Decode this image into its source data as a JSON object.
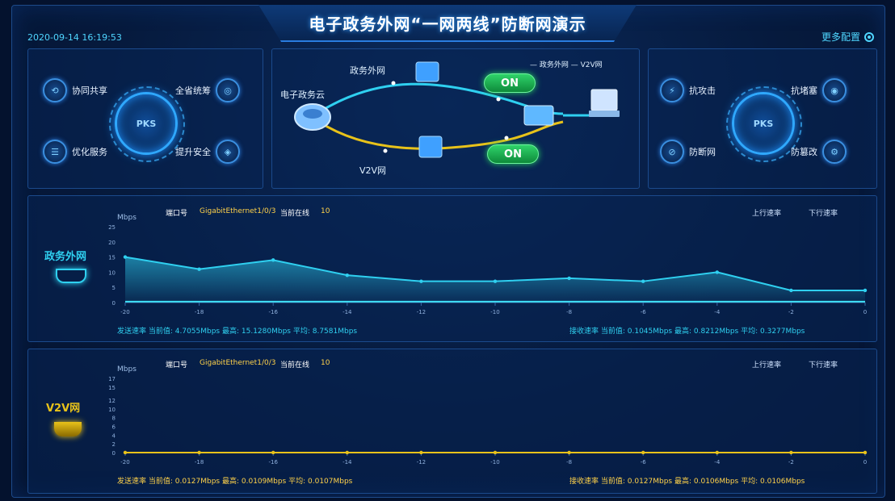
{
  "header": {
    "title": "电子政务外网“一网两线”防断网演示",
    "datetime": "2020-09-14 16:19:53",
    "settings_label": "更多配置"
  },
  "left_panel": {
    "hub_label": "PKS",
    "features": [
      {
        "label": "协同共享",
        "icon": "share-icon"
      },
      {
        "label": "全省统筹",
        "icon": "network-icon"
      },
      {
        "label": "优化服务",
        "icon": "service-icon"
      },
      {
        "label": "提升安全",
        "icon": "shield-icon"
      }
    ]
  },
  "middle_panel": {
    "cloud_label": "电子政务云",
    "upper_line_label": "政务外网",
    "lower_line_label": "V2V网",
    "upper_status": "ON",
    "lower_status": "ON",
    "legend": "— 政务外网 — V2V网"
  },
  "right_panel": {
    "hub_label": "PKS",
    "features": [
      {
        "label": "抗攻击",
        "icon": "attack-icon"
      },
      {
        "label": "抗堵塞",
        "icon": "congestion-icon"
      },
      {
        "label": "防断网",
        "icon": "disconnect-icon"
      },
      {
        "label": "防篡改",
        "icon": "tamper-icon"
      }
    ]
  },
  "colors": {
    "cyan": "#2fd0f0",
    "yellow": "#e8c21a",
    "text_yellow": "#ffd24a",
    "green": "#2fd36a"
  },
  "charts": [
    {
      "side_label": "政务外网",
      "port_label": "端口号",
      "port_value": "GigabitEthernet1/0/3",
      "stat_label": "当前在线",
      "stat_value": "10",
      "legend_up": "上行速率",
      "legend_down": "下行速率",
      "unit": "Mbps",
      "send_stats": "发送速率 当前值: 4.7055Mbps 最高: 15.1280Mbps 平均: 8.7581Mbps",
      "recv_stats": "接收速率 当前值: 0.1045Mbps 最高: 0.8212Mbps 平均: 0.3277Mbps"
    },
    {
      "side_label": "V2V网",
      "port_label": "端口号",
      "port_value": "GigabitEthernet1/0/3",
      "stat_label": "当前在线",
      "stat_value": "10",
      "legend_up": "上行速率",
      "legend_down": "下行速率",
      "unit": "Mbps",
      "send_stats": "发送速率 当前值: 0.0127Mbps 最高: 0.0109Mbps 平均: 0.0107Mbps",
      "recv_stats": "接收速率 当前值: 0.0127Mbps 最高: 0.0106Mbps 平均: 0.0106Mbps"
    }
  ],
  "chart_data": [
    {
      "type": "area",
      "ylabel": "Mbps",
      "x": [
        -20,
        -18,
        -16,
        -14,
        -12,
        -10,
        -8,
        -6,
        -4,
        -2,
        0
      ],
      "ylim": [
        0,
        25
      ],
      "yticks": [
        0,
        5,
        10,
        15,
        20,
        25
      ],
      "series": [
        {
          "values": [
            15,
            11,
            14,
            9,
            7,
            7,
            8,
            7,
            10,
            4,
            4
          ]
        },
        {
          "values": [
            0.3,
            0.3,
            0.3,
            0.3,
            0.3,
            0.3,
            0.3,
            0.3,
            0.3,
            0.3,
            0.3
          ]
        }
      ]
    },
    {
      "type": "area",
      "ylabel": "Mbps",
      "x": [
        -20,
        -18,
        -16,
        -14,
        -12,
        -10,
        -8,
        -6,
        -4,
        -2,
        0
      ],
      "ylim": [
        0,
        17
      ],
      "yticks": [
        0,
        2,
        4,
        6,
        8,
        10,
        12,
        15,
        17
      ],
      "series": [
        {
          "values": [
            0.01,
            0.01,
            0.01,
            0.01,
            0.01,
            0.01,
            0.01,
            0.01,
            0.01,
            0.01,
            0.01
          ]
        },
        {
          "values": [
            0.01,
            0.01,
            0.01,
            0.01,
            0.01,
            0.01,
            0.01,
            0.01,
            0.01,
            0.01,
            0.01
          ]
        }
      ]
    }
  ]
}
